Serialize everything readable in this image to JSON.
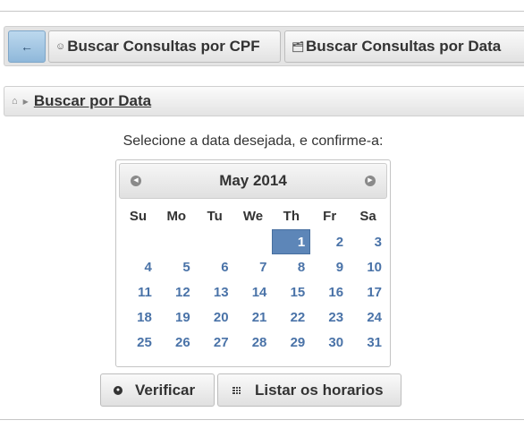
{
  "tabs": {
    "back_symbol": "←",
    "cpf_label": "Buscar Consultas por CPF",
    "data_label": "Buscar Consultas por Data"
  },
  "breadcrumb": {
    "link": "Buscar por Data"
  },
  "prompt": "Selecione a data desejada, e confirme-a:",
  "calendar": {
    "month_year": "May 2014",
    "weekdays": [
      "Su",
      "Mo",
      "Tu",
      "We",
      "Th",
      "Fr",
      "Sa"
    ],
    "weeks": [
      [
        "",
        "",
        "",
        "",
        "1",
        "2",
        "3"
      ],
      [
        "4",
        "5",
        "6",
        "7",
        "8",
        "9",
        "10"
      ],
      [
        "11",
        "12",
        "13",
        "14",
        "15",
        "16",
        "17"
      ],
      [
        "18",
        "19",
        "20",
        "21",
        "22",
        "23",
        "24"
      ],
      [
        "25",
        "26",
        "27",
        "28",
        "29",
        "30",
        "31"
      ]
    ],
    "selected": "1"
  },
  "buttons": {
    "verificar": "Verificar",
    "listar": "Listar os horarios"
  },
  "colors": {
    "accent": "#5d86b8",
    "day_text": "#4a73a8"
  }
}
